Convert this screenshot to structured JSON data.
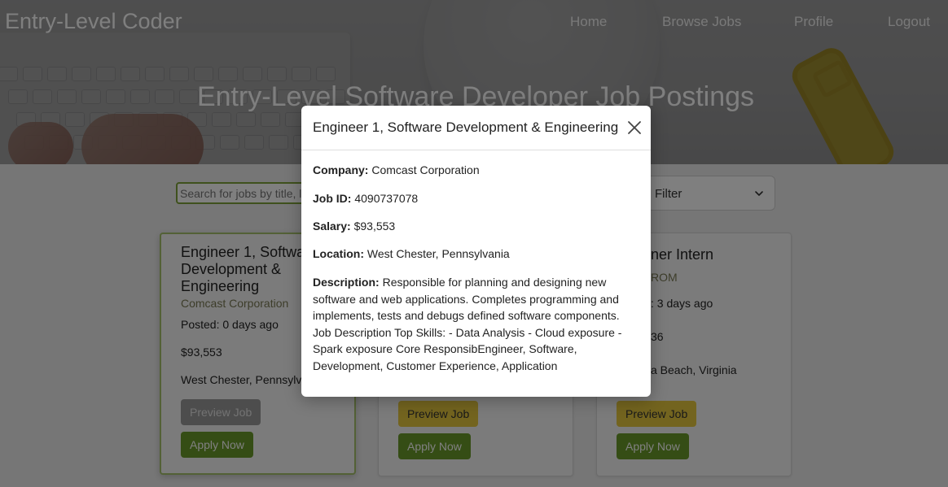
{
  "app": {
    "brand": "Entry-Level Coder",
    "nav": [
      "Home",
      "Browse Jobs",
      "Profile",
      "Logout"
    ],
    "hero_title": "Entry-Level Software Developer Job Postings"
  },
  "search": {
    "placeholder": "Search for jobs by title, location, or company"
  },
  "filter": {
    "label": "Filter"
  },
  "cards": [
    {
      "title": "Engineer 1, Software Development & Engineering",
      "company": "Comcast Corporation",
      "posted": "Posted: 0 days ago",
      "salary": "$93,553",
      "location": "West Chester, Pennsylvania",
      "preview": "Preview Job",
      "apply": "Apply Now"
    },
    {
      "preview": "Preview Job",
      "apply": "Apply Now"
    },
    {
      "title_visible": "ner Intern",
      "company_visible": "ROM",
      "posted_visible": ": 3 days ago",
      "salary_visible": "36",
      "location_visible": "a Beach, Virginia",
      "preview": "Preview Job",
      "apply": "Apply Now"
    }
  ],
  "modal": {
    "title": "Engineer 1, Software Development & Engineering",
    "company_label": "Company:",
    "company": "Comcast Corporation",
    "jobid_label": "Job ID:",
    "jobid": "4090737078",
    "salary_label": "Salary:",
    "salary": "$93,553",
    "location_label": "Location:",
    "location": "West Chester, Pennsylvania",
    "description_label": "Description:",
    "description": "Responsible for planning and designing new software and web applications. Completes programming and implements, tests and debugs defined software components. Job Description Top Skills: - Data Analysis - Cloud exposure - Spark exposure Core ResponsibEngineer, Software, Development, Customer Experience, Application"
  },
  "colors": {
    "apply_green": "#6b9b2a",
    "preview_yellow": "#e7c93e",
    "search_border": "#7ea33a"
  },
  "icons": [
    "close-icon",
    "chevron-down-icon"
  ]
}
